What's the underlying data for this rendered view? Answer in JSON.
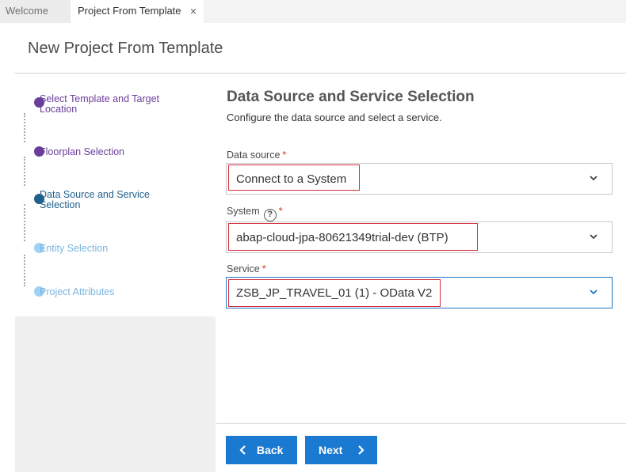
{
  "tabs": [
    {
      "label": "Welcome"
    },
    {
      "label": "Project From Template",
      "close": "×"
    }
  ],
  "page": {
    "title": "New Project From Template"
  },
  "steps": [
    {
      "label": "Select Template and Target Location",
      "state": "done"
    },
    {
      "label": "Floorplan Selection",
      "state": "done"
    },
    {
      "label": "Data Source and Service Selection",
      "state": "current"
    },
    {
      "label": "Entity Selection",
      "state": "todo"
    },
    {
      "label": "Project Attributes",
      "state": "todo"
    }
  ],
  "section": {
    "title": "Data Source and Service Selection",
    "description": "Configure the data source and select a service."
  },
  "fields": {
    "data_source": {
      "label": "Data source",
      "required": "*",
      "value": "Connect to a System"
    },
    "system": {
      "label": "System",
      "help": "?",
      "required": "*",
      "value": "abap-cloud-jpa-80621349trial-dev (BTP)"
    },
    "service": {
      "label": "Service",
      "required": "*",
      "value": "ZSB_JP_TRAVEL_01 (1) - OData V2"
    }
  },
  "buttons": {
    "back": "Back",
    "next": "Next"
  },
  "colors": {
    "accent": "#1a7ad1",
    "step_done": "#6b3d9a",
    "step_current": "#1f5f8b",
    "step_todo": "#9fd1f4",
    "highlight": "#d32f3c"
  },
  "icons": {
    "tab_close": "close-icon",
    "dropdown": "chevron-down-icon",
    "back": "chevron-left-icon",
    "next": "chevron-right-icon",
    "help": "help-icon"
  }
}
